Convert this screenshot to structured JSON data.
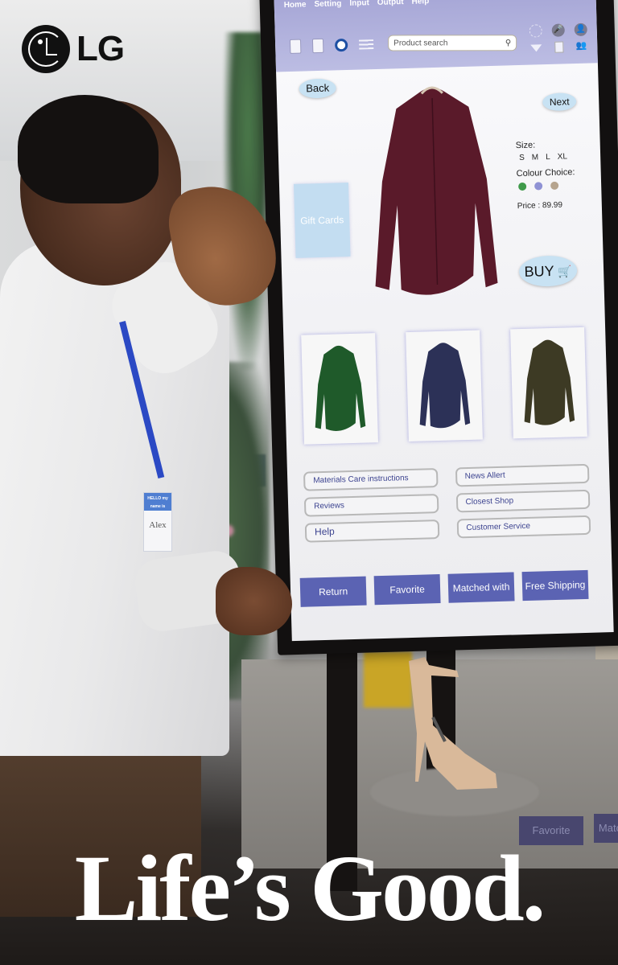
{
  "brand": {
    "logo_text": "LG",
    "tagline": "Life’s Good."
  },
  "kiosk": {
    "menu": [
      "Home",
      "Setting",
      "Input",
      "Output",
      "Help"
    ],
    "toolbar_left_icons": [
      "book-icon",
      "document-icon",
      "gear-icon",
      "hamburger-menu-icon"
    ],
    "search": {
      "placeholder": "Product search",
      "icon": "search-icon"
    },
    "toolbar_right_icons": [
      "loading-icon",
      "microphone-icon",
      "user-profile-icon",
      "dropdown-triangle-icon",
      "clothing-icon",
      "users-icon"
    ],
    "back_label": "Back",
    "next_label": "Next",
    "gift_cards_label": "Gift Cards",
    "product": {
      "size_label": "Size:",
      "sizes": [
        "S",
        "M",
        "L",
        "XL"
      ],
      "colour_label": "Colour Choice:",
      "colours": [
        "#3f9a4a",
        "#8f92d4",
        "#b6a48e"
      ],
      "price_label": "Price : 89.99",
      "main_color": "#5a1a2a"
    },
    "buy_label": "BUY",
    "thumbnails": [
      {
        "name": "green-shirt",
        "color": "#1f5a2a"
      },
      {
        "name": "navy-shirt",
        "color": "#2c3157"
      },
      {
        "name": "olive-shirt",
        "color": "#3d3a24"
      }
    ],
    "links_left": [
      "Materials  Care instructions",
      "Reviews",
      "Help"
    ],
    "links_right": [
      "News  Allert",
      "Closest Shop",
      "Customer Service"
    ],
    "actions": [
      "Return",
      "Favorite",
      "Matched with",
      "Free Shipping"
    ],
    "accent_color": "#5b63b3",
    "topbar_color": "#a9aad9"
  },
  "badge": {
    "header": "HELLO my name is",
    "name": "Alex"
  },
  "reflection": {
    "favorite": "Favorite",
    "matched": "Matc"
  }
}
